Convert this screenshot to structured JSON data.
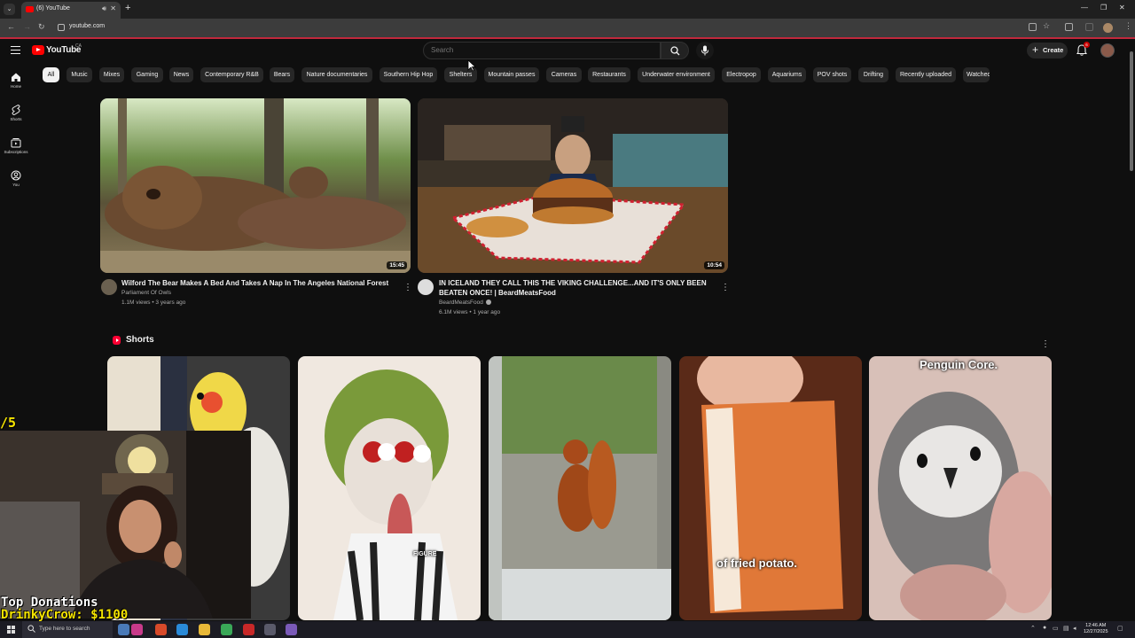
{
  "browser": {
    "tab_title": "(6) YouTube",
    "url": "youtube.com"
  },
  "header": {
    "logo_text": "YouTube",
    "logo_country": "CA",
    "search_placeholder": "Search",
    "create_label": "Create",
    "notifications_count": "6"
  },
  "chips": [
    "All",
    "Music",
    "Mixes",
    "Gaming",
    "News",
    "Contemporary R&B",
    "Bears",
    "Nature documentaries",
    "Southern Hip Hop",
    "Shelters",
    "Mountain passes",
    "Cameras",
    "Restaurants",
    "Underwater environment",
    "Electropop",
    "Aquariums",
    "POV shots",
    "Drifting",
    "Recently uploaded",
    "Watched"
  ],
  "active_chip": "All",
  "sidebar": {
    "items": [
      {
        "label": "Home",
        "icon": "home-icon"
      },
      {
        "label": "Shorts",
        "icon": "shorts-icon"
      },
      {
        "label": "Subscriptions",
        "icon": "subscriptions-icon"
      },
      {
        "label": "You",
        "icon": "you-icon"
      }
    ]
  },
  "videos": [
    {
      "title": "Wilford The Bear Makes A Bed And Takes A Nap In The Angeles National Forest",
      "channel": "Parliament Of Owls",
      "meta": "1.1M views • 3 years ago",
      "duration": "15:45"
    },
    {
      "title": "IN ICELAND THEY CALL THIS THE VIKING CHALLENGE...AND IT'S ONLY BEEN BEATEN ONCE! | BeardMeatsFood",
      "channel": "BeardMeatsFood",
      "meta": "6.1M views • 1 year ago",
      "duration": "10:54"
    }
  ],
  "shorts": {
    "title": "Shorts",
    "captions": [
      "",
      "",
      "",
      "of fried potato.",
      "Penguin Core."
    ],
    "thumb_overlay_text": "FIGURE"
  },
  "stream_overlay": {
    "counter": "/5",
    "donations_title": "Top Donations",
    "donations_value": "DrinkyCrow: $1100"
  },
  "taskbar": {
    "search_text": "Type here to search",
    "time": "12:46 AM",
    "date": "12/27/2025"
  }
}
